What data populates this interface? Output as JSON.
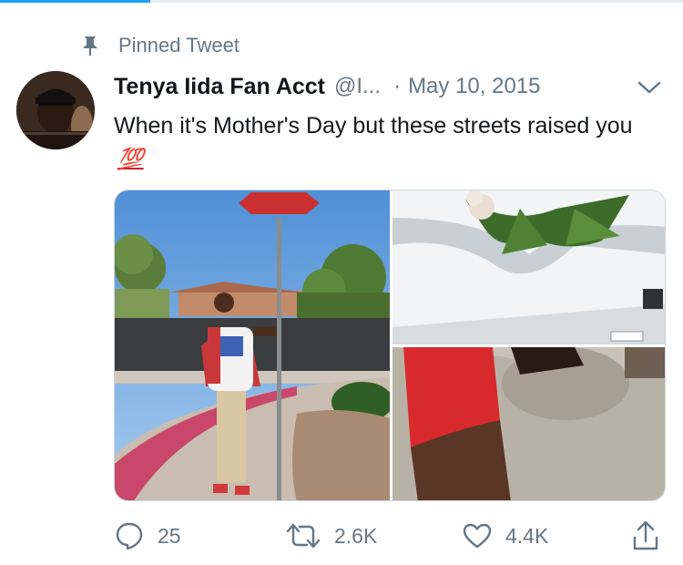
{
  "pinned": {
    "label": "Pinned Tweet",
    "icon": "pin-icon"
  },
  "tweet": {
    "display_name": "Tenya Iida Fan Acct",
    "handle": "@I...",
    "separator": "·",
    "date": "May 10, 2015",
    "text": "When it's Mother's Day but these streets raised you",
    "emoji": "💯",
    "media": [
      {
        "name": "photo-man-at-stop-sign"
      },
      {
        "name": "photo-casket-with-flowers"
      },
      {
        "name": "photo-red-sleeve-arm"
      }
    ]
  },
  "actions": {
    "reply_count": "25",
    "retweet_count": "2.6K",
    "like_count": "4.4K"
  },
  "colors": {
    "accent": "#1da1f2",
    "secondary_text": "#657786",
    "primary_text": "#14171a",
    "border": "#e6ecf0"
  }
}
